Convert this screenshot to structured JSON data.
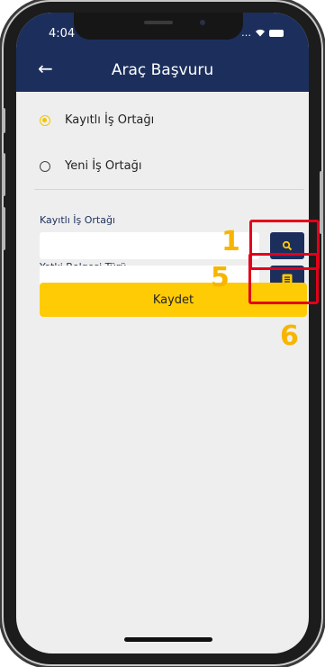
{
  "status_bar": {
    "time": "4:04",
    "signal": "…"
  },
  "header": {
    "title": "Araç Başvuru"
  },
  "options": [
    {
      "label": "Kayıtlı İş Ortağı",
      "selected": true
    },
    {
      "label": "Yeni İş Ortağı",
      "selected": false
    }
  ],
  "fields": [
    {
      "label": "Kayıtlı İş Ortağı",
      "value": "",
      "button_icon": "search-icon"
    },
    {
      "label": "Yetki Belgesi Türü",
      "value": "",
      "button_icon": "list-icon"
    }
  ],
  "save_label": "Kaydet",
  "annotations": [
    "1",
    "5",
    "6"
  ],
  "colors": {
    "header": "#1c2f5c",
    "accent": "#ffcb05",
    "highlight": "#e2001a",
    "annotation": "#f7b500"
  }
}
